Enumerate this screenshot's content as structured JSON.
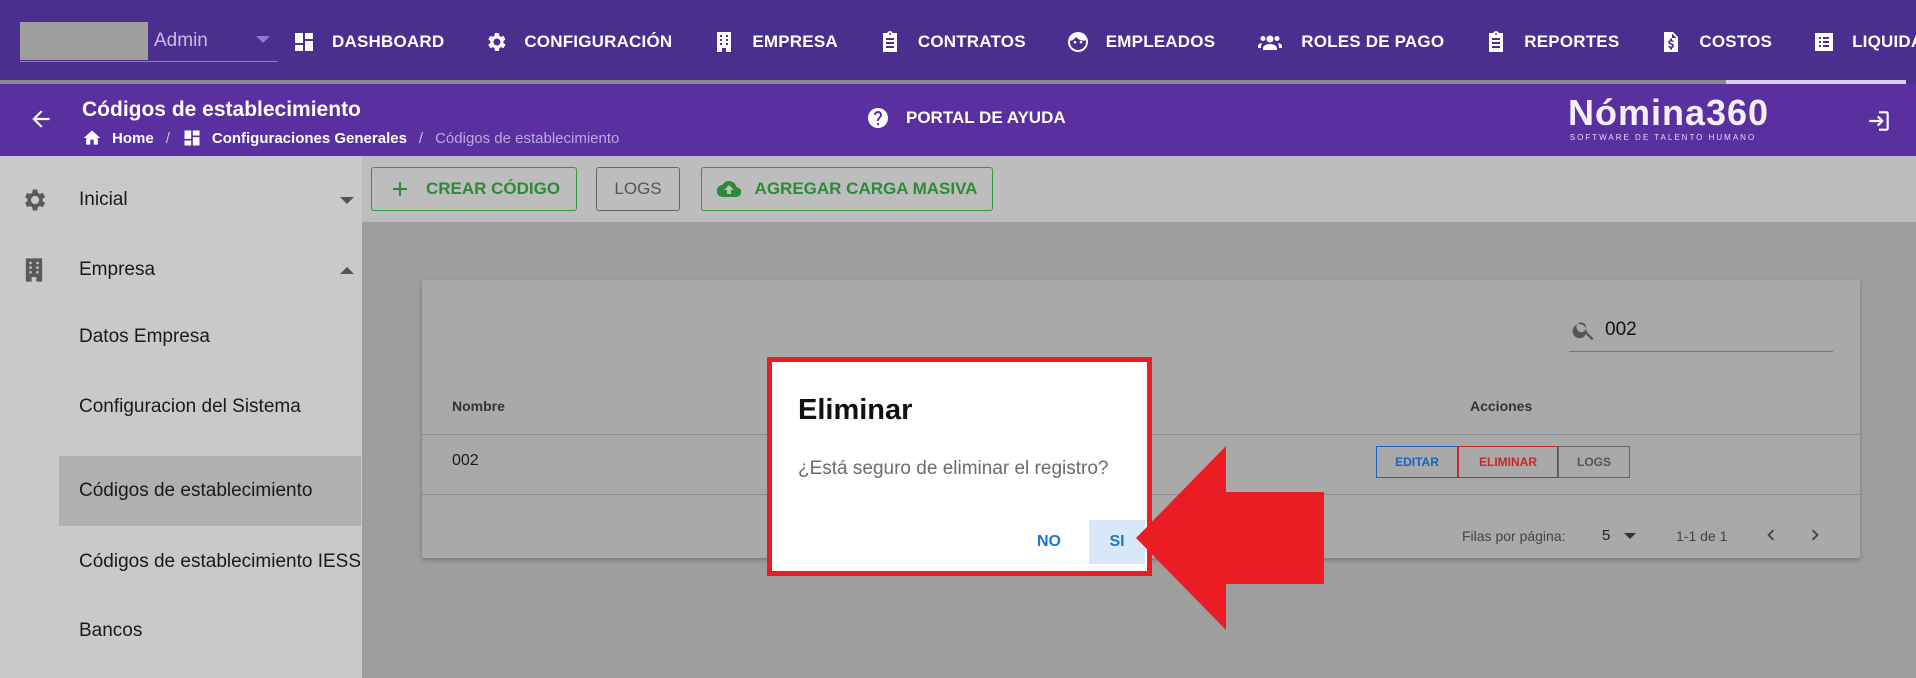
{
  "topnav": {
    "user": {
      "name": "Admin"
    },
    "items": [
      {
        "label": "DASHBOARD",
        "icon": "dashboard-icon"
      },
      {
        "label": "CONFIGURACIÓN",
        "icon": "gear-icon"
      },
      {
        "label": "EMPRESA",
        "icon": "building-icon"
      },
      {
        "label": "CONTRATOS",
        "icon": "clipboard-icon"
      },
      {
        "label": "EMPLEADOS",
        "icon": "face-icon"
      },
      {
        "label": "ROLES DE PAGO",
        "icon": "group-icon"
      },
      {
        "label": "REPORTES",
        "icon": "clipboard-icon"
      },
      {
        "label": "COSTOS",
        "icon": "file-dollar-icon"
      },
      {
        "label": "LIQUIDACIONES",
        "icon": "list-icon"
      }
    ]
  },
  "header": {
    "title": "Códigos de establecimiento",
    "breadcrumb": [
      "Home",
      "Configuraciones Generales",
      "Códigos de establecimiento"
    ],
    "help": "PORTAL DE AYUDA",
    "brand": {
      "name": "Nómina360",
      "tagline": "SOFTWARE DE TALENTO HUMANO"
    }
  },
  "sidebar": {
    "groups": [
      {
        "label": "Inicial",
        "icon": "gear-icon",
        "expanded": false
      },
      {
        "label": "Empresa",
        "icon": "building-icon",
        "expanded": true
      }
    ],
    "items": [
      "Datos Empresa",
      "Configuracion del Sistema",
      "Códigos de establecimiento",
      "Códigos de establecimiento IESS",
      "Bancos"
    ],
    "active_item": "Códigos de establecimiento"
  },
  "toolbar": {
    "create_label": "CREAR CÓDIGO",
    "logs_label": "LOGS",
    "bulk_label": "AGREGAR CARGA MASIVA"
  },
  "table": {
    "search_value": "002",
    "columns": [
      "Nombre",
      "Acciones"
    ],
    "rows": [
      {
        "nombre": "002"
      }
    ],
    "row_actions": [
      "EDITAR",
      "ELIMINAR",
      "LOGS"
    ],
    "pagination": {
      "rows_label": "Filas por página:",
      "rows_per_page": "5",
      "range": "1-1 de 1"
    }
  },
  "dialog": {
    "title": "Eliminar",
    "message": "¿Está seguro de eliminar el registro?",
    "no_label": "NO",
    "yes_label": "SI"
  },
  "colors": {
    "nav_bg": "#4a2f8f",
    "subheader_bg": "#5a2fa0",
    "accent_green": "#2e8a36",
    "dialog_button": "#1976d2",
    "highlight_red": "#ec1c24"
  }
}
